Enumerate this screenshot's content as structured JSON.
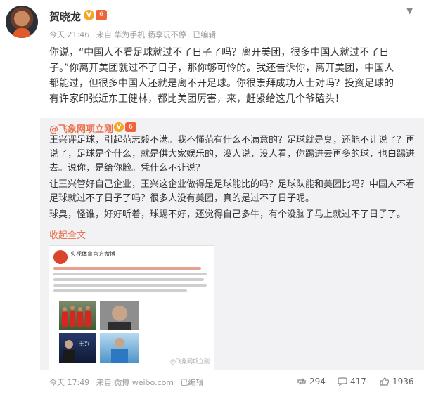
{
  "author": {
    "name": "贺晓龙",
    "v_badge": "V",
    "level_badge": "6"
  },
  "meta": {
    "time": "今天 21:46",
    "source": "来自 华为手机 畅享玩不停",
    "edited": "已编辑"
  },
  "body_lines": [
    "你说，“中国人不看足球就过不了日子了吗？离开美团，很多中国人就过不了日",
    "子。”你离开美团就过不了日子，那你够可怜的。我还告诉你，离开美团，中国人",
    "都能过，但很多中国人还就是离不开足球。你很崇拜成功人士对吗？投资足球的",
    "有许家印张近东王健林，都比美团厉害，来，赶紧给这几个爷磕头！"
  ],
  "repost": {
    "author": "@飞象网项立刚",
    "v_badge": "V",
    "level_badge": "6",
    "paragraphs": [
      "王兴评足球，引起范志毅不满。我不懂范有什么不满意的？足球就是臭，还能不让说了？再说了，足球是个什么，就是供大家娱乐的，没人说，没人看，你踢进去再多的球，也白踢进去。说你，是给你脸。凭什么不让说？",
      "让王兴管好自己企业，王兴这企业做得是足球能比的吗？足球队能和美团比吗？中国人不看足球就过不了日子了吗？很多人没有美团，真的是过不了日子呢。",
      "球臭，怪谁，好好听着，球踢不好，还觉得自己多牛，有个没脑子马上就过不了日子了。"
    ],
    "collapse_label": "收起全文",
    "thumb": {
      "title": "央视体育官方微博",
      "watermark": "@飞象网项立刚",
      "caption": "王兴"
    },
    "footer": {
      "time": "今天 17:49",
      "source": "来自 微博 weibo.com",
      "edited": "已编辑"
    },
    "actions": {
      "repost_count": "294",
      "comment_count": "417",
      "like_count": "1936"
    }
  },
  "colors": {
    "accent": "#eb7350",
    "repost_bg": "#f2f2f5"
  },
  "icons": {
    "menu": "chevron-down-icon",
    "repost": "repost-icon",
    "comment": "comment-icon",
    "like": "like-icon"
  }
}
